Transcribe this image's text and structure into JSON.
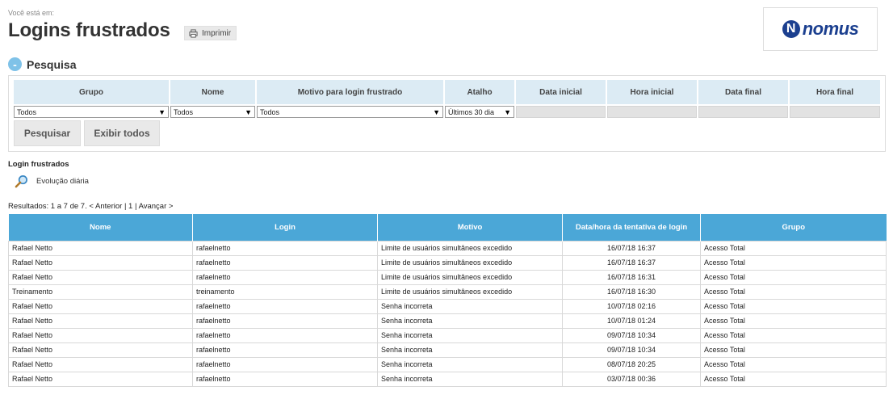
{
  "breadcrumb": "Você está em:",
  "title": "Logins frustrados",
  "print_label": "Imprimir",
  "logo": {
    "letter": "N",
    "text": "nomus"
  },
  "section": {
    "toggle": "-",
    "title": "Pesquisa"
  },
  "filters": [
    {
      "label": "Grupo",
      "value": "Todos",
      "type": "select"
    },
    {
      "label": "Nome",
      "value": "Todos",
      "type": "select"
    },
    {
      "label": "Motivo para login frustrado",
      "value": "Todos",
      "type": "select"
    },
    {
      "label": "Atalho",
      "value": "Últimos 30 dia",
      "type": "select"
    },
    {
      "label": "Data inicial",
      "value": "",
      "type": "input"
    },
    {
      "label": "Hora inicial",
      "value": "",
      "type": "input"
    },
    {
      "label": "Data final",
      "value": "",
      "type": "input"
    },
    {
      "label": "Hora final",
      "value": "",
      "type": "input"
    }
  ],
  "buttons": {
    "search": "Pesquisar",
    "show_all": "Exibir todos"
  },
  "subtitle": "Login frustrados",
  "evolution_link": "Evolução diária",
  "results": {
    "summary": "Resultados: 1 a 7 de 7.",
    "prev": "< Anterior",
    "sep1": "|",
    "page": "1",
    "sep2": "|",
    "next": "Avançar >"
  },
  "table": {
    "headers": [
      "Nome",
      "Login",
      "Motivo",
      "Data/hora da tentativa de login",
      "Grupo"
    ],
    "rows": [
      [
        "Rafael Netto",
        "rafaelnetto",
        "Limite de usuários simultâneos excedido",
        "16/07/18 16:37",
        "Acesso Total"
      ],
      [
        "Rafael Netto",
        "rafaelnetto",
        "Limite de usuários simultâneos excedido",
        "16/07/18 16:37",
        "Acesso Total"
      ],
      [
        "Rafael Netto",
        "rafaelnetto",
        "Limite de usuários simultâneos excedido",
        "16/07/18 16:31",
        "Acesso Total"
      ],
      [
        "Treinamento",
        "treinamento",
        "Limite de usuários simultâneos excedido",
        "16/07/18 16:30",
        "Acesso Total"
      ],
      [
        "Rafael Netto",
        "rafaelnetto",
        "Senha incorreta",
        "10/07/18 02:16",
        "Acesso Total"
      ],
      [
        "Rafael Netto",
        "rafaelnetto",
        "Senha incorreta",
        "10/07/18 01:24",
        "Acesso Total"
      ],
      [
        "Rafael Netto",
        "rafaelnetto",
        "Senha incorreta",
        "09/07/18 10:34",
        "Acesso Total"
      ],
      [
        "Rafael Netto",
        "rafaelnetto",
        "Senha incorreta",
        "09/07/18 10:34",
        "Acesso Total"
      ],
      [
        "Rafael Netto",
        "rafaelnetto",
        "Senha incorreta",
        "08/07/18 20:25",
        "Acesso Total"
      ],
      [
        "Rafael Netto",
        "rafaelnetto",
        "Senha incorreta",
        "03/07/18 00:36",
        "Acesso Total"
      ]
    ]
  },
  "colors": {
    "header_blue": "#4ba7d7",
    "filter_label_bg": "#dcebf4",
    "brand": "#1b3f8f"
  }
}
